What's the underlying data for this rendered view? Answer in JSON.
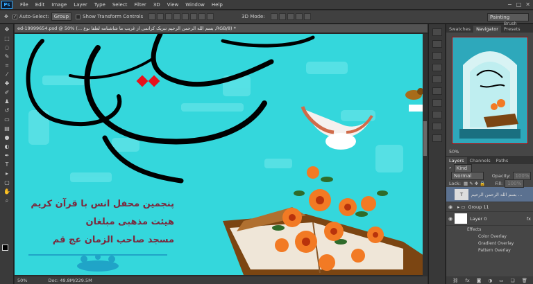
{
  "app": {
    "logo": "Ps"
  },
  "menu": [
    "File",
    "Edit",
    "Image",
    "Layer",
    "Type",
    "Select",
    "Filter",
    "3D",
    "View",
    "Window",
    "Help"
  ],
  "options": {
    "auto_select_label": "Auto-Select:",
    "auto_select_value": "Group",
    "show_transform_label": "Show Transform Controls",
    "mode_3d_label": "3D Mode:",
    "workspace": "Painting"
  },
  "document": {
    "tab_title": "ed-19999654.psd @ 50% (... بسم الله الرحمن الرحيم تبریک کراتمی از غریب ما شاشنامه لطفا نوع ,RGB/8) *",
    "status": "Doc: 49.8M/229.5M",
    "zoom_readout": "50%"
  },
  "canvas_text": {
    "line1": "پنجمین محفل انس با قرآن کریم",
    "line2": "هیئت مذهبی مبلغان",
    "line3": "مسجد صاحب الزمان عج قم"
  },
  "panel": {
    "top_tabs": [
      "Swatches",
      "Navigator",
      "Brush Presets"
    ],
    "nav_zoom": "50%",
    "layer_tabs": [
      "Layers",
      "Channels",
      "Paths"
    ],
    "kind_label": "Kind",
    "blend_mode": "Normal",
    "opacity_label": "Opacity:",
    "opacity_value": "100%",
    "lock_label": "Lock:",
    "fill_label": "Fill:",
    "fill_value": "100%",
    "layers": [
      {
        "name": "بسم الله الرحمن الرحیم ...",
        "thumb": "T"
      },
      {
        "name": "Group 11",
        "thumb": ""
      },
      {
        "name": "Layer 0",
        "thumb": ""
      }
    ],
    "effects_label": "Effects",
    "effects": [
      "Color Overlay",
      "Gradient Overlay",
      "Pattern Overlay"
    ]
  },
  "colors": {
    "canvas_bg": "#34d7dc",
    "text_maroon": "#7a2a3e",
    "ui_dark": "#3c3c3c"
  }
}
